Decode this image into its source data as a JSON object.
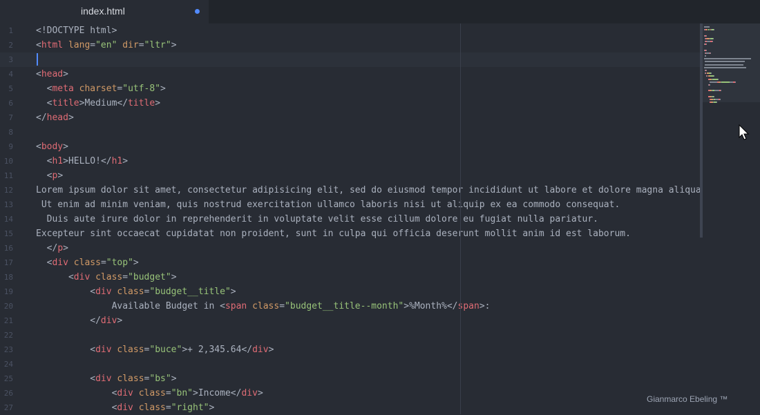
{
  "tab": {
    "title": "index.html",
    "modified": true
  },
  "editor": {
    "cursor_line": 3,
    "lines": [
      [
        [
          "doc",
          "<!DOCTYPE html>"
        ]
      ],
      [
        [
          "punc",
          "<"
        ],
        [
          "tag",
          "html"
        ],
        [
          "punc",
          " "
        ],
        [
          "attr",
          "lang"
        ],
        [
          "punc",
          "="
        ],
        [
          "str",
          "\"en\""
        ],
        [
          "punc",
          " "
        ],
        [
          "attr",
          "dir"
        ],
        [
          "punc",
          "="
        ],
        [
          "str",
          "\"ltr\""
        ],
        [
          "punc",
          ">"
        ]
      ],
      [],
      [
        [
          "punc",
          "<"
        ],
        [
          "tag",
          "head"
        ],
        [
          "punc",
          ">"
        ]
      ],
      [
        [
          "punc",
          "  <"
        ],
        [
          "tag",
          "meta"
        ],
        [
          "punc",
          " "
        ],
        [
          "attr",
          "charset"
        ],
        [
          "punc",
          "="
        ],
        [
          "str",
          "\"utf-8\""
        ],
        [
          "punc",
          ">"
        ]
      ],
      [
        [
          "punc",
          "  <"
        ],
        [
          "tag",
          "title"
        ],
        [
          "punc",
          ">"
        ],
        [
          "text",
          "Medium"
        ],
        [
          "punc",
          "</"
        ],
        [
          "tag",
          "title"
        ],
        [
          "punc",
          ">"
        ]
      ],
      [
        [
          "punc",
          "</"
        ],
        [
          "tag",
          "head"
        ],
        [
          "punc",
          ">"
        ]
      ],
      [],
      [
        [
          "punc",
          "<"
        ],
        [
          "tag",
          "body"
        ],
        [
          "punc",
          ">"
        ]
      ],
      [
        [
          "punc",
          "  <"
        ],
        [
          "tag",
          "h1"
        ],
        [
          "punc",
          ">"
        ],
        [
          "text",
          "HELLO!"
        ],
        [
          "punc",
          "</"
        ],
        [
          "tag",
          "h1"
        ],
        [
          "punc",
          ">"
        ]
      ],
      [
        [
          "punc",
          "  <"
        ],
        [
          "tag",
          "p"
        ],
        [
          "punc",
          ">"
        ]
      ],
      [
        [
          "text",
          "Lorem ipsum dolor sit amet, consectetur adipisicing elit, sed do eiusmod tempor incididunt ut labore et dolore magna aliqua."
        ]
      ],
      [
        [
          "text",
          " Ut enim ad minim veniam, quis nostrud exercitation ullamco laboris nisi ut aliquip ex ea commodo consequat."
        ]
      ],
      [
        [
          "text",
          "  Duis aute irure dolor in reprehenderit in voluptate velit esse cillum dolore eu fugiat nulla pariatur."
        ]
      ],
      [
        [
          "text",
          "Excepteur sint occaecat cupidatat non proident, sunt in culpa qui officia deserunt mollit anim id est laborum."
        ]
      ],
      [
        [
          "punc",
          "  </"
        ],
        [
          "tag",
          "p"
        ],
        [
          "punc",
          ">"
        ]
      ],
      [
        [
          "punc",
          "  <"
        ],
        [
          "tag",
          "div"
        ],
        [
          "punc",
          " "
        ],
        [
          "attr",
          "class"
        ],
        [
          "punc",
          "="
        ],
        [
          "str",
          "\"top\""
        ],
        [
          "punc",
          ">"
        ]
      ],
      [
        [
          "punc",
          "      <"
        ],
        [
          "tag",
          "div"
        ],
        [
          "punc",
          " "
        ],
        [
          "attr",
          "class"
        ],
        [
          "punc",
          "="
        ],
        [
          "str",
          "\"budget\""
        ],
        [
          "punc",
          ">"
        ]
      ],
      [
        [
          "punc",
          "          <"
        ],
        [
          "tag",
          "div"
        ],
        [
          "punc",
          " "
        ],
        [
          "attr",
          "class"
        ],
        [
          "punc",
          "="
        ],
        [
          "str",
          "\"budget__title\""
        ],
        [
          "punc",
          ">"
        ]
      ],
      [
        [
          "text",
          "              Available Budget in "
        ],
        [
          "punc",
          "<"
        ],
        [
          "tag",
          "span"
        ],
        [
          "punc",
          " "
        ],
        [
          "attr",
          "class"
        ],
        [
          "punc",
          "="
        ],
        [
          "str",
          "\"budget__title--month\""
        ],
        [
          "punc",
          ">"
        ],
        [
          "text",
          "%Month%"
        ],
        [
          "punc",
          "</"
        ],
        [
          "tag",
          "span"
        ],
        [
          "punc",
          ">"
        ],
        [
          "text",
          ":"
        ]
      ],
      [
        [
          "punc",
          "          </"
        ],
        [
          "tag",
          "div"
        ],
        [
          "punc",
          ">"
        ]
      ],
      [],
      [
        [
          "punc",
          "          <"
        ],
        [
          "tag",
          "div"
        ],
        [
          "punc",
          " "
        ],
        [
          "attr",
          "class"
        ],
        [
          "punc",
          "="
        ],
        [
          "str",
          "\"buce\""
        ],
        [
          "punc",
          ">"
        ],
        [
          "text",
          "+ 2,345.64"
        ],
        [
          "punc",
          "</"
        ],
        [
          "tag",
          "div"
        ],
        [
          "punc",
          ">"
        ]
      ],
      [],
      [
        [
          "punc",
          "          <"
        ],
        [
          "tag",
          "div"
        ],
        [
          "punc",
          " "
        ],
        [
          "attr",
          "class"
        ],
        [
          "punc",
          "="
        ],
        [
          "str",
          "\"bs\""
        ],
        [
          "punc",
          ">"
        ]
      ],
      [
        [
          "punc",
          "              <"
        ],
        [
          "tag",
          "div"
        ],
        [
          "punc",
          " "
        ],
        [
          "attr",
          "class"
        ],
        [
          "punc",
          "="
        ],
        [
          "str",
          "\"bn\""
        ],
        [
          "punc",
          ">"
        ],
        [
          "text",
          "Income"
        ],
        [
          "punc",
          "</"
        ],
        [
          "tag",
          "div"
        ],
        [
          "punc",
          ">"
        ]
      ],
      [
        [
          "punc",
          "              <"
        ],
        [
          "tag",
          "div"
        ],
        [
          "punc",
          " "
        ],
        [
          "attr",
          "class"
        ],
        [
          "punc",
          "="
        ],
        [
          "str",
          "\"right\""
        ],
        [
          "punc",
          ">"
        ]
      ]
    ]
  },
  "watermark": "Gianmarco Ebeling ™",
  "colors": {
    "background": "#282c34",
    "tag": "#e06c75",
    "attribute": "#d19a66",
    "string": "#98c379",
    "text": "#abb2bf",
    "cursor": "#528bff"
  },
  "icons": {
    "tab_modified": "modified-dot-icon",
    "mouse": "mouse-pointer-icon"
  }
}
